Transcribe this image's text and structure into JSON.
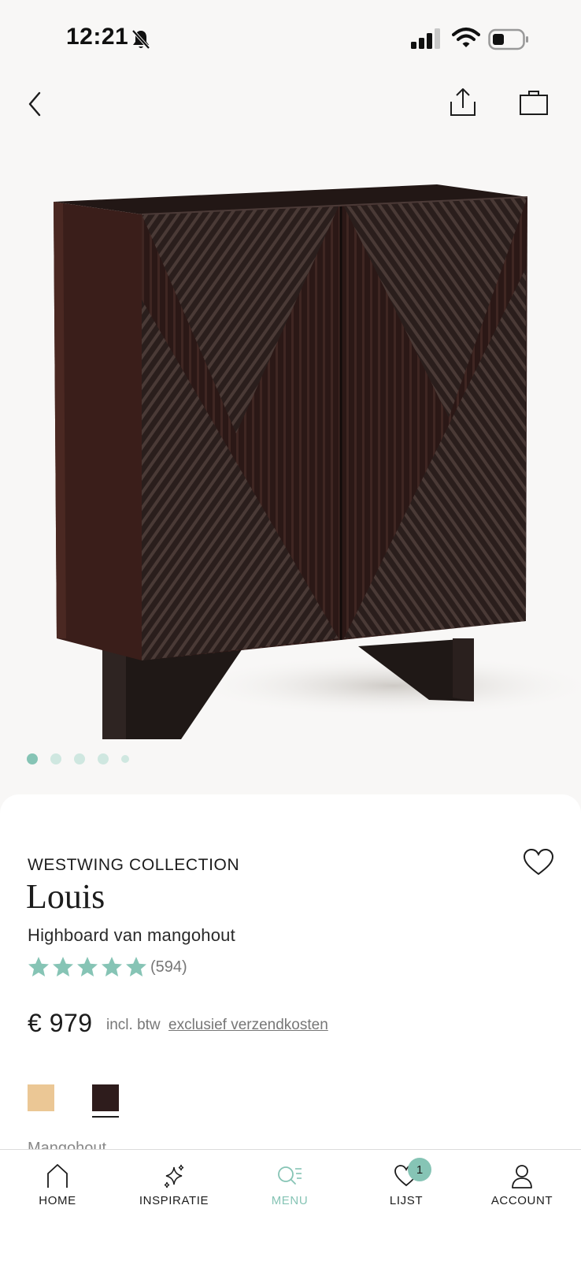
{
  "status_bar": {
    "time": "12:21",
    "icons": [
      "bell-slash-icon",
      "cellular-signal-icon",
      "wifi-icon",
      "battery-icon"
    ]
  },
  "top_nav": {
    "icons": [
      "chevron-left-icon",
      "share-icon",
      "shopping-bag-icon"
    ]
  },
  "gallery": {
    "image": "dark mango wood highboard with diagonal fluted doors",
    "image_count": 5,
    "active_index": 0
  },
  "product": {
    "brand": "WESTWING COLLECTION",
    "name": "Louis",
    "subtitle": "Highboard van mangohout",
    "rating_stars": 5,
    "review_count": "(594)",
    "price": "€ 979",
    "vat_text": "incl. btw",
    "shipping_link": "exclusief verzendkosten",
    "swatches": [
      {
        "color": "#ebc795",
        "selected": false
      },
      {
        "color": "#2e1c1c",
        "selected": true
      }
    ],
    "material": "Mangohout"
  },
  "colors": {
    "accent": "#86c4b5",
    "accent_light": "#cfe7e0",
    "text": "#1c1c1c",
    "muted": "#777777"
  },
  "tab_bar": {
    "items": [
      {
        "label": "HOME",
        "icon": "home-icon"
      },
      {
        "label": "INSPIRATIE",
        "icon": "sparkles-icon"
      },
      {
        "label": "MENU",
        "icon": "search-menu-icon",
        "active": true
      },
      {
        "label": "LIJST",
        "icon": "heart-icon",
        "badge": "1"
      },
      {
        "label": "ACCOUNT",
        "icon": "user-icon"
      }
    ]
  }
}
